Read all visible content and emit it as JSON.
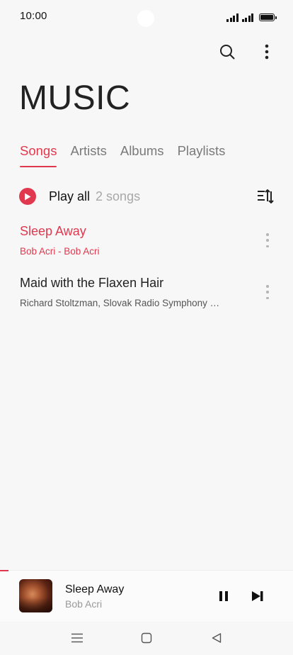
{
  "status_bar": {
    "time": "10:00"
  },
  "toolbar": {
    "search_icon": "search-icon",
    "more_icon": "more-vertical-icon"
  },
  "page": {
    "title": "MUSIC"
  },
  "tabs": [
    {
      "label": "Songs",
      "active": true
    },
    {
      "label": "Artists",
      "active": false
    },
    {
      "label": "Albums",
      "active": false
    },
    {
      "label": "Playlists",
      "active": false
    }
  ],
  "play_all": {
    "label": "Play all",
    "count": "2 songs"
  },
  "songs": [
    {
      "title": "Sleep Away",
      "subtitle": "Bob Acri - Bob Acri",
      "playing": true
    },
    {
      "title": "Maid with the Flaxen Hair",
      "subtitle": "Richard Stoltzman, Slovak Radio Symphony …",
      "playing": false
    }
  ],
  "now_playing": {
    "title": "Sleep Away",
    "artist": "Bob Acri",
    "progress_fraction": 0.03,
    "state": "playing"
  },
  "colors": {
    "accent": "#e0394f",
    "background": "#f7f7f7"
  }
}
